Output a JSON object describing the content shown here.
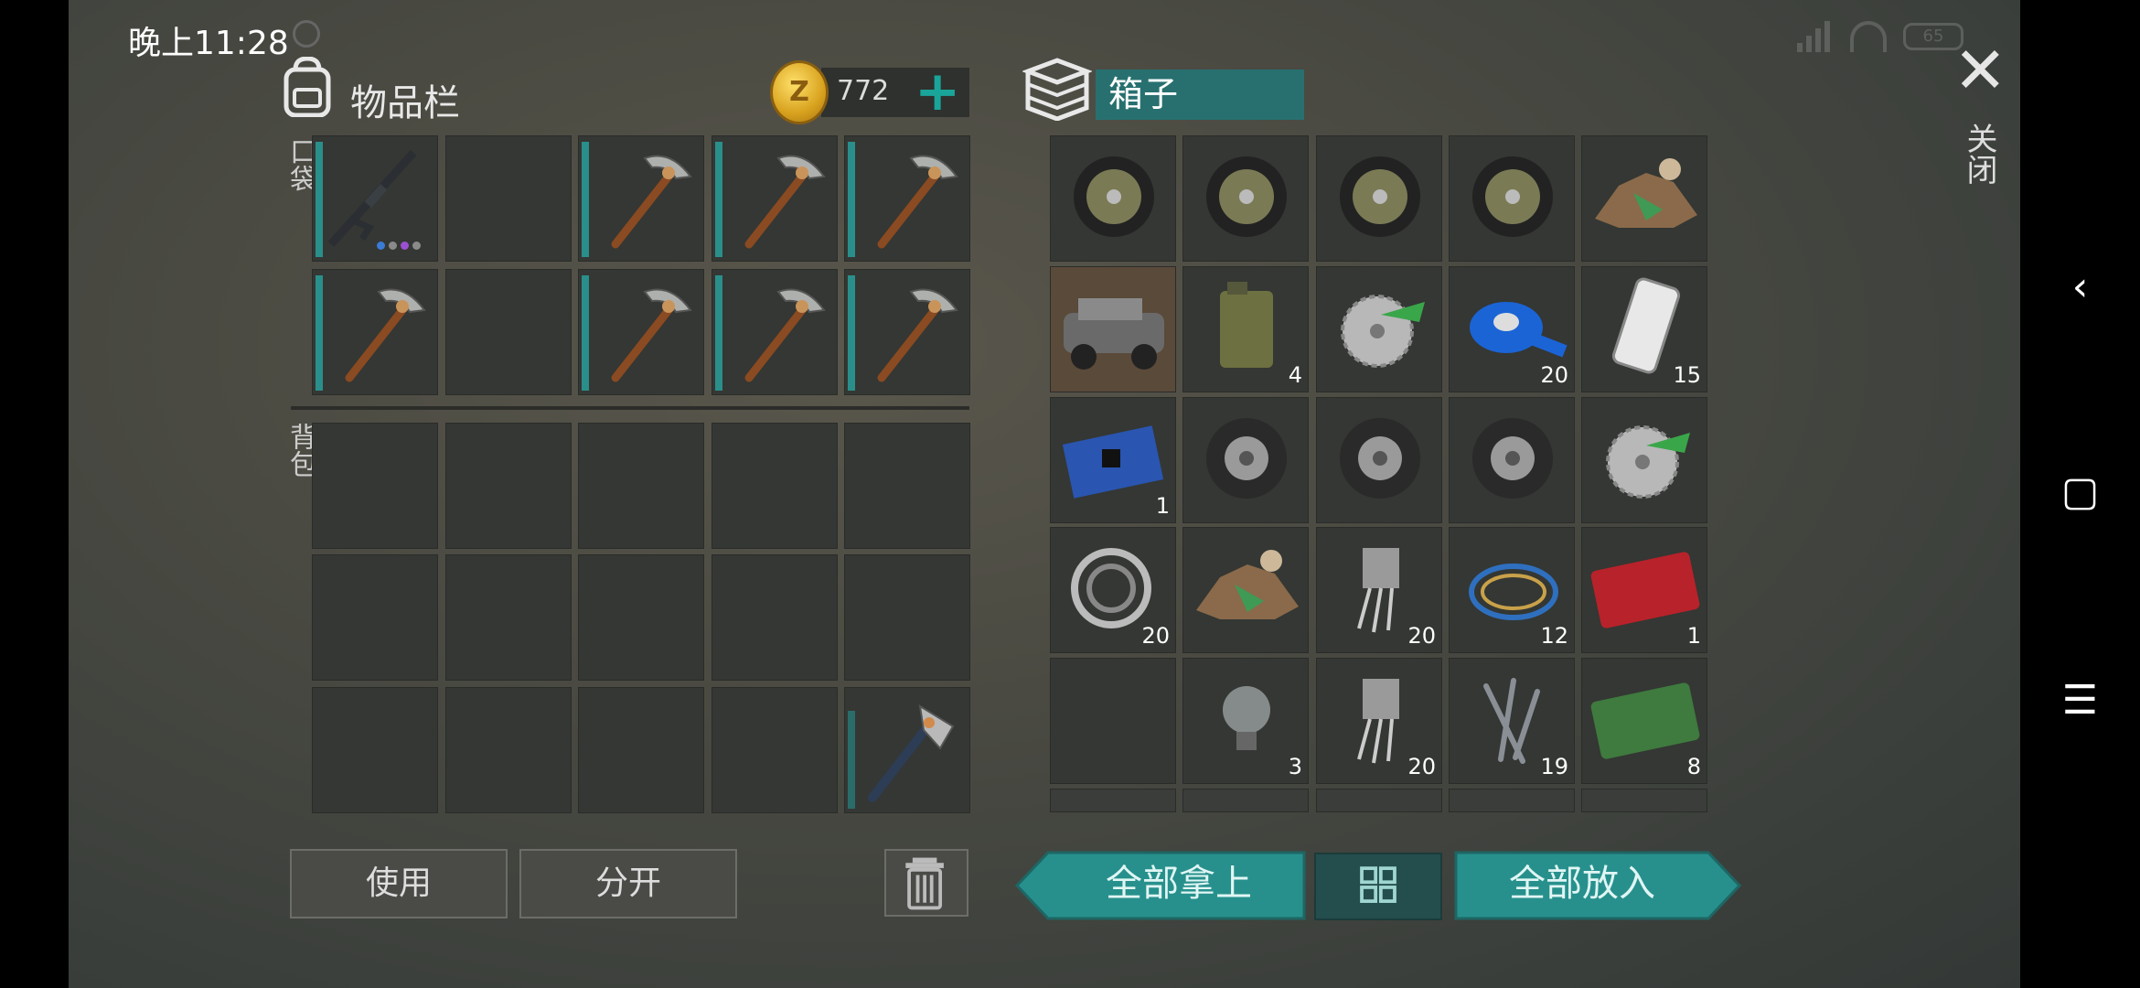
{
  "status": {
    "time": "晚上11:28",
    "battery": "65"
  },
  "inventory": {
    "title": "物品栏",
    "coins": "772",
    "add_label": "+",
    "pocket_label": "口袋",
    "backpack_label": "背包",
    "pocket_items": [
      "rifle-icon",
      "",
      "pickaxe-icon",
      "pickaxe-icon",
      "pickaxe-icon",
      "pickaxe-icon",
      "",
      "pickaxe-icon",
      "pickaxe-icon",
      "pickaxe-icon"
    ],
    "backpack_items": [
      "",
      "",
      "",
      "",
      "",
      "",
      "",
      "",
      "",
      "",
      "",
      "",
      "",
      "",
      "hatchet-icon"
    ]
  },
  "box": {
    "title": "箱子",
    "close_label": "关闭",
    "items": [
      {
        "icon": "wheel-hub-icon",
        "qty": ""
      },
      {
        "icon": "wheel-hub-icon",
        "qty": ""
      },
      {
        "icon": "wheel-hub-icon",
        "qty": ""
      },
      {
        "icon": "wheel-hub-icon",
        "qty": ""
      },
      {
        "icon": "scrap-pile-icon",
        "qty": ""
      },
      {
        "icon": "vehicle-icon",
        "qty": ""
      },
      {
        "icon": "jerrycan-icon",
        "qty": "4"
      },
      {
        "icon": "saw-blade-icon",
        "qty": ""
      },
      {
        "icon": "tape-icon",
        "qty": "20"
      },
      {
        "icon": "phone-icon",
        "qty": "15"
      },
      {
        "icon": "circuit-board-icon",
        "qty": "1"
      },
      {
        "icon": "tire-icon",
        "qty": ""
      },
      {
        "icon": "tire-icon",
        "qty": ""
      },
      {
        "icon": "tire-icon",
        "qty": ""
      },
      {
        "icon": "saw-blade-icon",
        "qty": ""
      },
      {
        "icon": "bearing-icon",
        "qty": "20"
      },
      {
        "icon": "scrap-pile-icon",
        "qty": ""
      },
      {
        "icon": "transistor-icon",
        "qty": "20"
      },
      {
        "icon": "wire-icon",
        "qty": "12"
      },
      {
        "icon": "combat-coupon-icon",
        "qty": "1"
      },
      {
        "icon": "",
        "qty": ""
      },
      {
        "icon": "light-bulb-icon",
        "qty": "3"
      },
      {
        "icon": "transistor-icon",
        "qty": "20"
      },
      {
        "icon": "nails-icon",
        "qty": "19"
      },
      {
        "icon": "ration-coupon-icon",
        "qty": "8"
      }
    ]
  },
  "buttons": {
    "use": "使用",
    "split": "分开",
    "take_all": "全部拿上",
    "put_all": "全部放入"
  },
  "colors": {
    "accent": "#27908c",
    "cell": "#343733"
  }
}
